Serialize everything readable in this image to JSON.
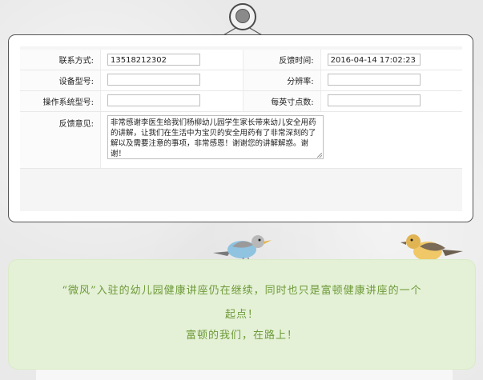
{
  "form": {
    "contact_label": "联系方式:",
    "contact_value": "13518212302",
    "feedback_time_label": "反馈时间:",
    "feedback_time_value": "2016-04-14 17:02:23",
    "device_model_label": "设备型号:",
    "device_model_value": "",
    "resolution_label": "分辨率:",
    "resolution_value": "",
    "os_model_label": "操作系统型号:",
    "os_model_value": "",
    "ppi_label": "每英寸点数:",
    "ppi_value": "",
    "feedback_label": "反馈意见:",
    "feedback_text": "非常感谢李医生给我们杨柳幼儿园学生家长带来幼儿安全用药的讲解，让我们在生活中为宝贝的安全用药有了非常深刻的了解以及需要注意的事项，非常感恩！谢谢您的讲解解惑。谢谢！"
  },
  "message": {
    "line1": "“微风”入驻的幼儿园健康讲座仍在继续，同时也只是富顿健康讲座的一个",
    "line2": "起点！",
    "line3": "富顿的我们，在路上！"
  },
  "colors": {
    "message_bg": "#e4f1d6",
    "message_text": "#6f9a3a",
    "frame_border": "#555555"
  },
  "icons": [
    "pin-icon",
    "blue-bird-icon",
    "yellow-bird-icon"
  ]
}
